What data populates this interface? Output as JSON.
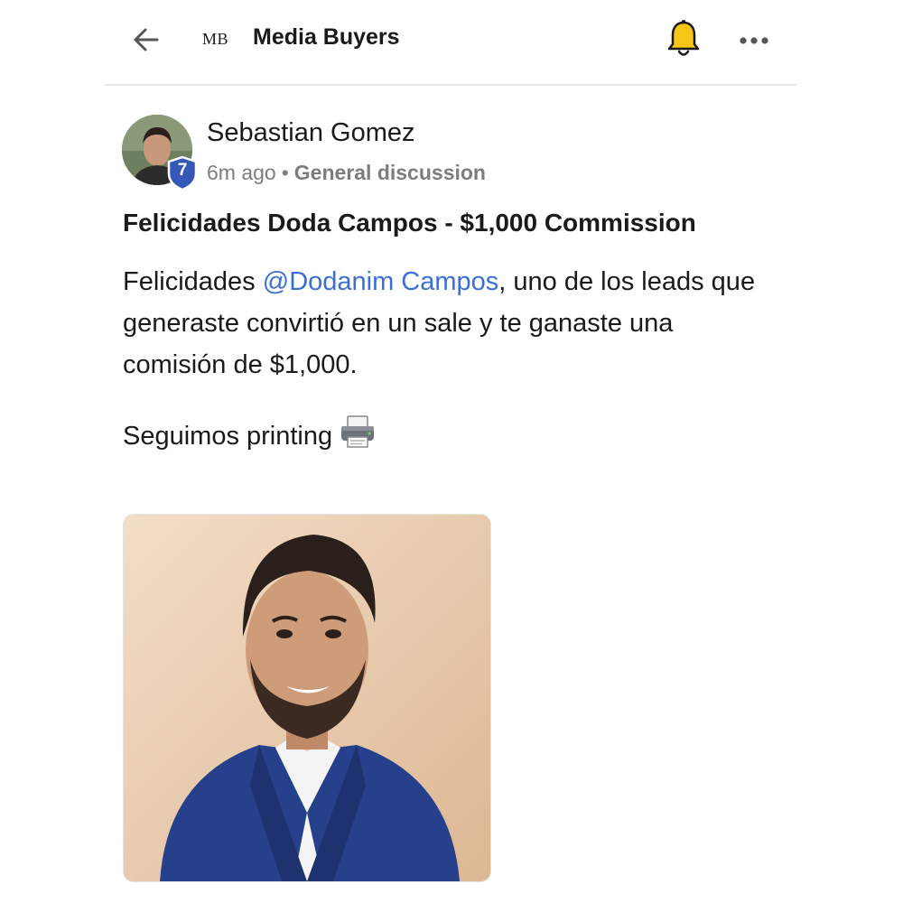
{
  "header": {
    "logo_text": "MB",
    "title": "Media Buyers",
    "back_icon": "arrow-left-icon",
    "bell_icon": "bell-icon",
    "more_icon": "more-horizontal-icon"
  },
  "post": {
    "author": {
      "name": "Sebastian Gomez",
      "level": "7"
    },
    "time": "6m ago",
    "separator": "•",
    "category": "General discussion",
    "title": "Felicidades Doda Campos - $1,000 Commission",
    "body_before_mention": "Felicidades ",
    "mention": "@Dodanim Campos",
    "body_after_mention": ", uno de los leads que generaste convirtió en un sale y te ganaste una comisión de $1,000.",
    "closing": "Seguimos printing",
    "closing_icon": "printer-icon"
  },
  "colors": {
    "accent_link": "#3a6fd8",
    "bell_yellow": "#f5c518",
    "badge_blue": "#3557b7"
  }
}
